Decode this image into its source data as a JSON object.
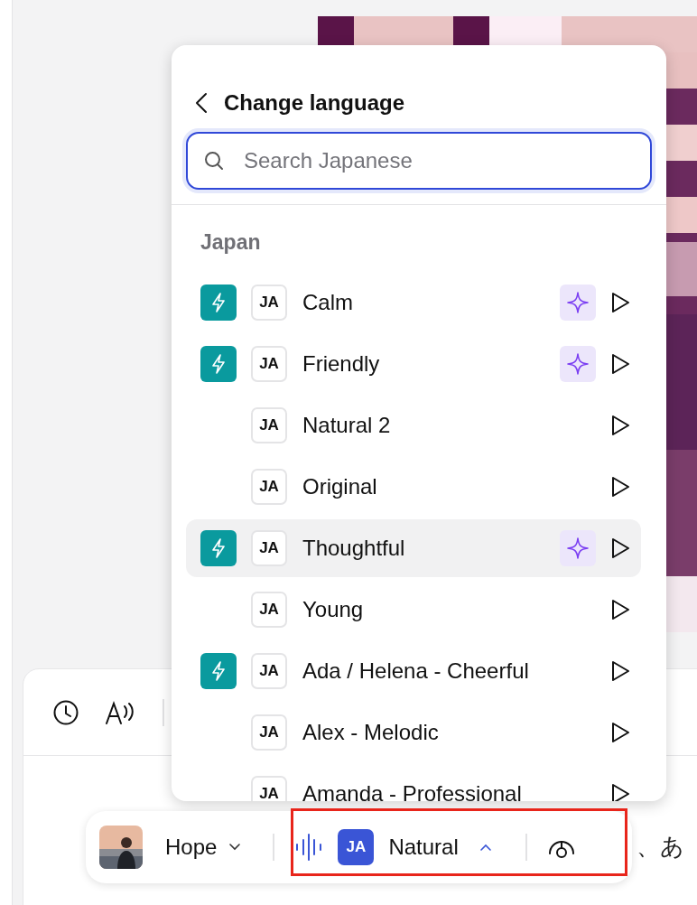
{
  "menu": {
    "title": "Change language",
    "search": {
      "placeholder": "Search Japanese"
    },
    "group": "Japan",
    "voices": [
      {
        "name": "Calm",
        "lang": "JA",
        "fast": true,
        "premium": true,
        "selected": false
      },
      {
        "name": "Friendly",
        "lang": "JA",
        "fast": true,
        "premium": true,
        "selected": false
      },
      {
        "name": "Natural 2",
        "lang": "JA",
        "fast": false,
        "premium": false,
        "selected": false
      },
      {
        "name": "Original",
        "lang": "JA",
        "fast": false,
        "premium": false,
        "selected": false
      },
      {
        "name": "Thoughtful",
        "lang": "JA",
        "fast": true,
        "premium": true,
        "selected": true
      },
      {
        "name": "Young",
        "lang": "JA",
        "fast": false,
        "premium": false,
        "selected": false
      },
      {
        "name": "Ada / Helena - Cheerful",
        "lang": "JA",
        "fast": true,
        "premium": false,
        "selected": false
      },
      {
        "name": "Alex - Melodic",
        "lang": "JA",
        "fast": false,
        "premium": false,
        "selected": false
      },
      {
        "name": "Amanda - Professional",
        "lang": "JA",
        "fast": false,
        "premium": false,
        "selected": false
      }
    ]
  },
  "voice_bar": {
    "speaker": {
      "name": "Hope",
      "expanded": false
    },
    "style": {
      "lang": "JA",
      "name": "Natural",
      "expanded": true
    },
    "highlighted": true
  },
  "editor": {
    "text": "、あ"
  }
}
